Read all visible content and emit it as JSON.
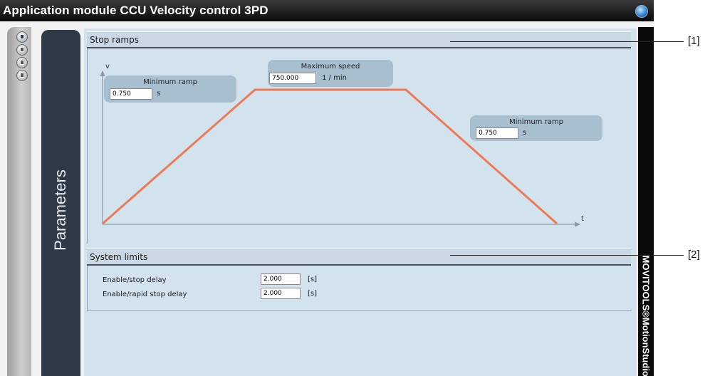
{
  "window": {
    "title": "Application module CCU Velocity control 3PD"
  },
  "side_panel": {
    "label": "Parameters"
  },
  "right_strip": {
    "label": "MOVITOOLS®MotionStudio"
  },
  "stop_ramps": {
    "header": "Stop ramps",
    "axis_v": "v",
    "axis_t": "t",
    "min_ramp_left": {
      "label": "Minimum ramp",
      "value": "0.750",
      "unit": "s"
    },
    "max_speed": {
      "label": "Maximum speed",
      "value": "750.000",
      "unit": "1 / min"
    },
    "min_ramp_right": {
      "label": "Minimum ramp",
      "value": "0.750",
      "unit": "s"
    }
  },
  "system_limits": {
    "header": "System limits",
    "rows": [
      {
        "label": "Enable/stop delay",
        "value": "2.000",
        "unit": "[s]"
      },
      {
        "label": "Enable/rapid stop delay",
        "value": "2.000",
        "unit": "[s]"
      }
    ]
  },
  "callouts": [
    "[1]",
    "[2]"
  ],
  "colors": {
    "profile_line": "#ee7a55",
    "content_bg": "#d3e3ee",
    "title_bar": "#111111"
  }
}
